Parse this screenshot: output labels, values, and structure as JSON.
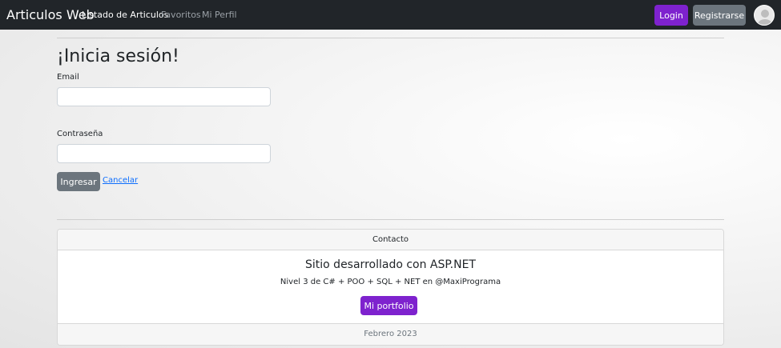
{
  "navbar": {
    "brand": "Articulos Web",
    "links": [
      {
        "label": "Listado de Articulos",
        "active": true
      },
      {
        "label": "Favoritos",
        "active": false
      },
      {
        "label": "Mi Perfil",
        "active": false
      }
    ],
    "login_label": "Login",
    "register_label": "Registrarse",
    "avatar_icon": "user-avatar-icon"
  },
  "login": {
    "title": "¡Inicia sesión!",
    "email_label": "Email",
    "email_value": "",
    "password_label": "Contraseña",
    "password_value": "",
    "submit_label": "Ingresar",
    "cancel_label": "Cancelar"
  },
  "footer_card": {
    "header": "Contacto",
    "title": "Sitio desarrollado con ASP.NET",
    "text": "Nivel 3 de C# + POO + SQL + NET en @MaxiPrograma",
    "button_label": "Mi portfolio",
    "footer": "Febrero 2023"
  },
  "colors": {
    "navbar_bg": "#212529",
    "accent_purple": "#7e22ce",
    "secondary_gray": "#6c757d",
    "link_blue": "#0d6efd"
  }
}
